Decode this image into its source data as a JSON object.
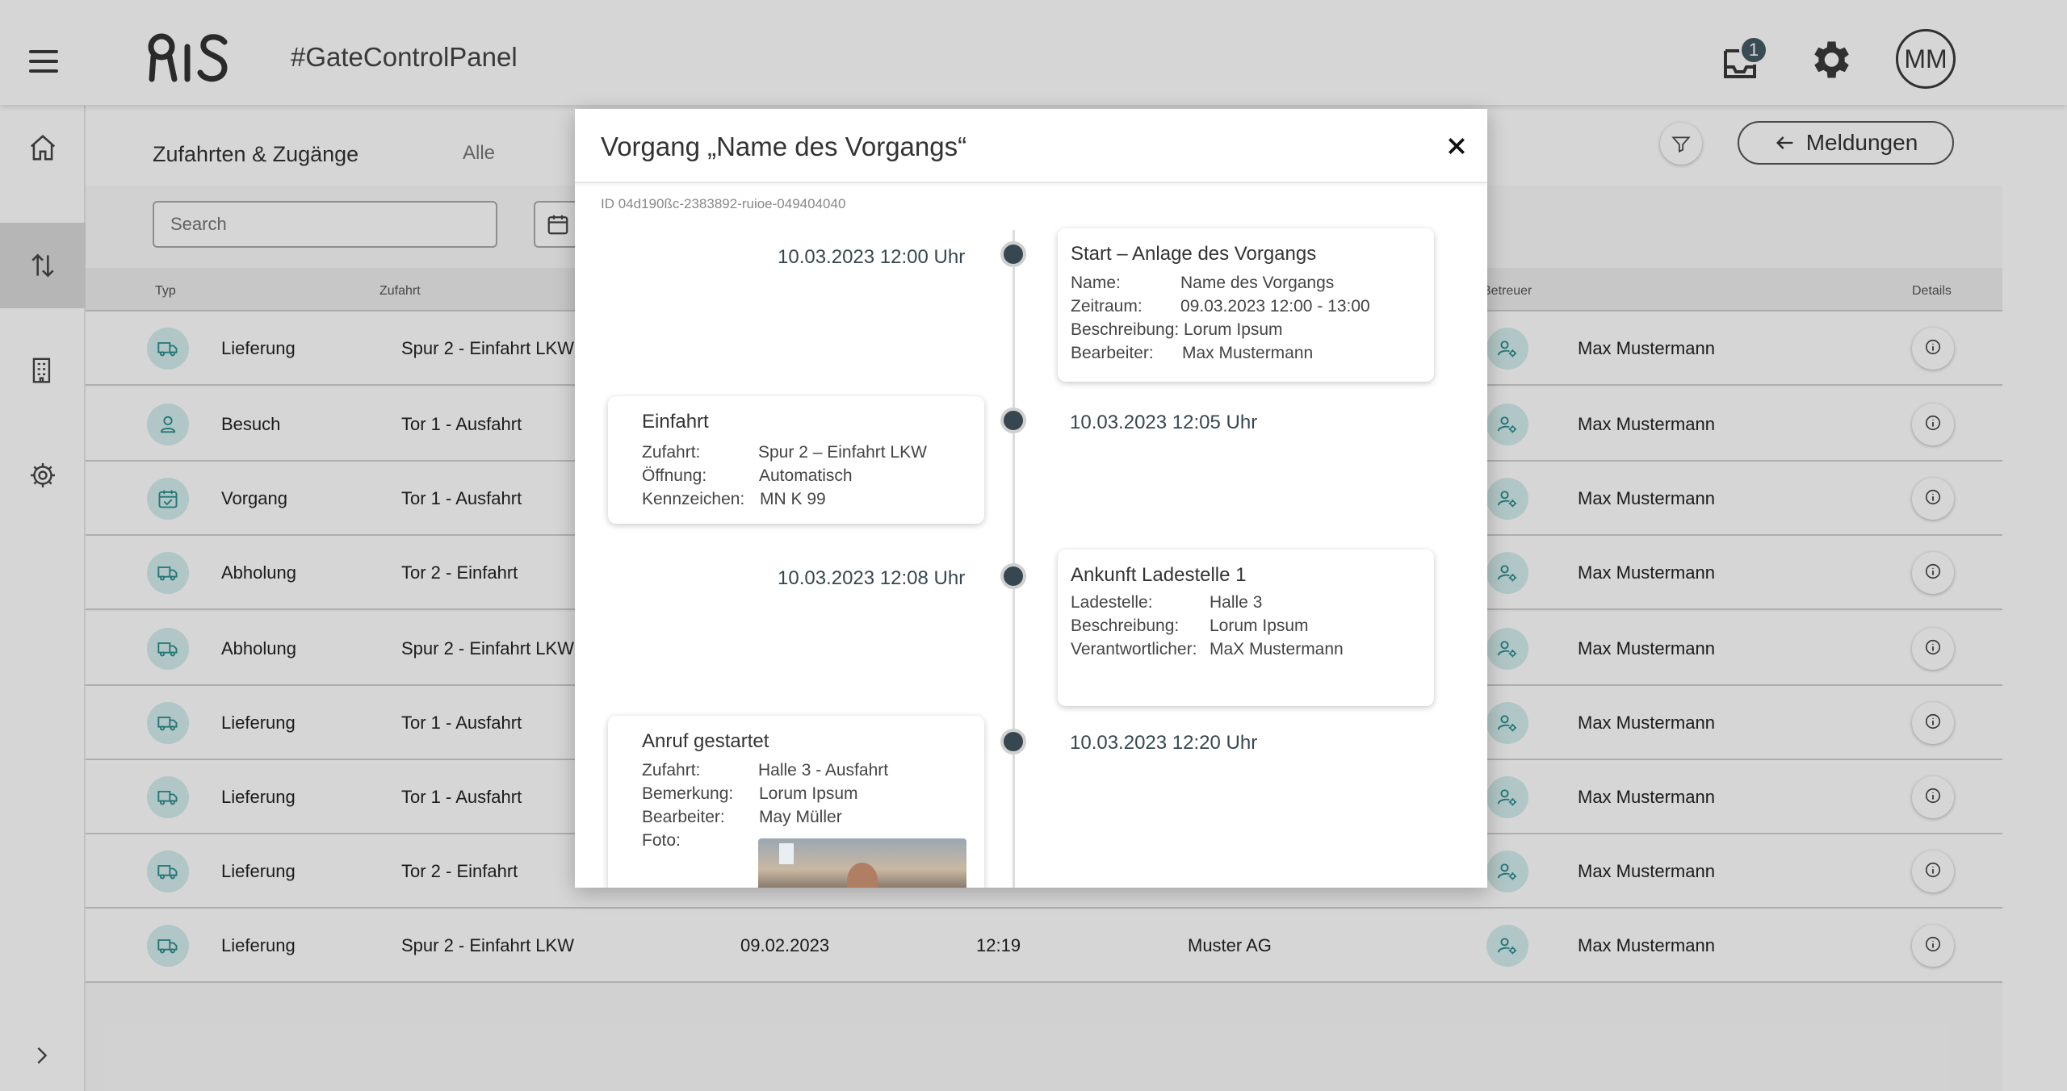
{
  "app": {
    "title": "#GateControlPanel",
    "notification_count": "1",
    "user_initials": "MM"
  },
  "sidebar": {
    "items": [
      {
        "name": "home",
        "icon": "home-icon"
      },
      {
        "name": "transfers",
        "icon": "up-down-arrows-icon",
        "active": true
      },
      {
        "name": "buildings",
        "icon": "building-icon"
      },
      {
        "name": "settings",
        "icon": "gear-icon"
      }
    ]
  },
  "page": {
    "section_title": "Zufahrten & Zugänge",
    "tab_all": "Alle",
    "meldungen_label": "Meldungen",
    "search_placeholder": "Search"
  },
  "table": {
    "headers": {
      "typ": "Typ",
      "zufahrt": "Zufahrt",
      "betreuer": "Betreuer",
      "details": "Details"
    },
    "rows": [
      {
        "typ": "Lieferung",
        "zufahrt": "Spur 2 - Einfahrt LKW",
        "betreuer": "Max Mustermann",
        "icon": "truck-icon"
      },
      {
        "typ": "Besuch",
        "zufahrt": "Tor 1 - Ausfahrt",
        "betreuer": "Max Mustermann",
        "icon": "person-icon"
      },
      {
        "typ": "Vorgang",
        "zufahrt": "Tor 1 - Ausfahrt",
        "betreuer": "Max Mustermann",
        "icon": "calendar-check-icon"
      },
      {
        "typ": "Abholung",
        "zufahrt": "Tor 2 - Einfahrt",
        "betreuer": "Max Mustermann",
        "icon": "truck-icon"
      },
      {
        "typ": "Abholung",
        "zufahrt": "Spur 2 - Einfahrt LKW",
        "betreuer": "Max Mustermann",
        "icon": "truck-icon"
      },
      {
        "typ": "Lieferung",
        "zufahrt": "Tor 1 - Ausfahrt",
        "betreuer": "Max Mustermann",
        "icon": "truck-icon"
      },
      {
        "typ": "Lieferung",
        "zufahrt": "Tor 1 - Ausfahrt",
        "betreuer": "Max Mustermann",
        "icon": "truck-icon"
      },
      {
        "typ": "Lieferung",
        "zufahrt": "Tor 2 - Einfahrt",
        "betreuer": "Max Mustermann",
        "icon": "truck-icon"
      },
      {
        "typ": "Lieferung",
        "zufahrt": "Spur 2 - Einfahrt LKW",
        "date": "09.02.2023",
        "time": "12:19",
        "company": "Muster AG",
        "betreuer": "Max Mustermann",
        "icon": "truck-icon"
      }
    ]
  },
  "modal": {
    "title": "Vorgang „Name des Vorgangs“",
    "id_text": "ID 04d190ßc-2383892-ruioe-049404040",
    "events": [
      {
        "time": "10.03.2023 12:00 Uhr",
        "title": "Start – Anlage des Vorgangs",
        "fields": [
          {
            "label": "Name:",
            "value": "Name des Vorgangs"
          },
          {
            "label": "Zeitraum:",
            "value": "09.03.2023 12:00 - 13:00"
          },
          {
            "label": "Beschreibung:",
            "value": "Lorum Ipsum"
          },
          {
            "label": "Bearbeiter:",
            "value": "Max Mustermann"
          }
        ]
      },
      {
        "time": "10.03.2023 12:05 Uhr",
        "title": "Einfahrt",
        "fields": [
          {
            "label": "Zufahrt:",
            "value": "Spur 2 – Einfahrt LKW"
          },
          {
            "label": "Öffnung:",
            "value": "Automatisch"
          },
          {
            "label": "Kennzeichen:",
            "value": "MN K 99"
          }
        ]
      },
      {
        "time": "10.03.2023 12:08 Uhr",
        "title": "Ankunft Ladestelle 1",
        "fields": [
          {
            "label": "Ladestelle:",
            "value": "Halle 3"
          },
          {
            "label": "Beschreibung:",
            "value": "Lorum Ipsum"
          },
          {
            "label": "Verantwortlicher:",
            "value": "MaX Mustermann"
          }
        ]
      },
      {
        "time": "10.03.2023 12:20 Uhr",
        "title": "Anruf gestartet",
        "fields": [
          {
            "label": "Zufahrt:",
            "value": "Halle 3 - Ausfahrt"
          },
          {
            "label": "Bemerkung:",
            "value": "Lorum Ipsum"
          },
          {
            "label": "Bearbeiter:",
            "value": "May Müller"
          },
          {
            "label": "Foto:",
            "value": ""
          }
        ]
      }
    ]
  },
  "colors": {
    "accent_teal": "#2a8c8c",
    "icon_bg": "#d3ecec",
    "timeline_dot": "#37474f"
  }
}
